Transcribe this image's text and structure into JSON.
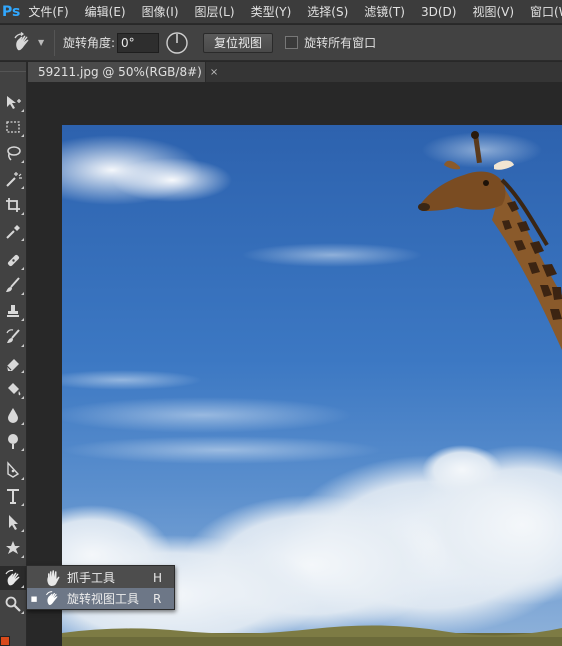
{
  "app": {
    "logo": "Ps"
  },
  "menu": {
    "items": [
      "文件(F)",
      "编辑(E)",
      "图像(I)",
      "图层(L)",
      "类型(Y)",
      "选择(S)",
      "滤镜(T)",
      "3D(D)",
      "视图(V)",
      "窗口(W"
    ]
  },
  "options": {
    "tool_icon": "rotate-view-icon",
    "angle_label": "旋转角度:",
    "angle_value": "0°",
    "reset_label": "复位视图",
    "rotate_all_label": "旋转所有窗口",
    "rotate_all_checked": false
  },
  "document": {
    "tab_title": "59211.jpg @ 50%(RGB/8#)",
    "tab_close": "×"
  },
  "toolbar": {
    "tools": [
      "move-icon",
      "marquee-icon",
      "lasso-icon",
      "magic-wand-icon",
      "crop-icon",
      "eyedropper-icon",
      "healing-brush-icon",
      "brush-icon",
      "clone-stamp-icon",
      "history-brush-icon",
      "eraser-icon",
      "paint-bucket-icon",
      "blur-icon",
      "dodge-icon",
      "pen-icon",
      "type-icon",
      "path-select-icon",
      "shape-icon",
      "rotate-view-icon",
      "zoom-icon"
    ],
    "active_tool": "rotate-view-icon",
    "foreground_color": "#d84a1b"
  },
  "flyout": {
    "items": [
      {
        "label": "抓手工具",
        "key": "H",
        "selected": false,
        "icon": "hand-icon"
      },
      {
        "label": "旋转视图工具",
        "key": "R",
        "selected": true,
        "icon": "rotate-view-icon"
      }
    ],
    "bullet": "■"
  },
  "colors": {
    "sky_top": "#2f64b0",
    "sky_mid": "#3f7cc6",
    "cloud": "#eef2f6",
    "giraffe": "#8a5a2b",
    "accent": "#31a8ff"
  }
}
